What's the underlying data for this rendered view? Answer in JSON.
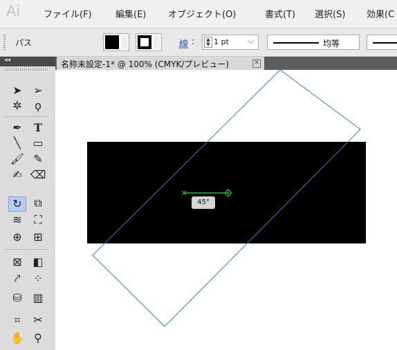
{
  "app": {
    "logo": "Ai"
  },
  "menu": [
    "ファイル(F)",
    "編集(E)",
    "オブジェクト(O)",
    "書式(T)",
    "選択(S)",
    "効果(C"
  ],
  "control": {
    "selection_label": "パス",
    "stroke_link": "線",
    "stroke_colon": ":",
    "stroke_weight": "1 pt",
    "stroke_profile": "均等"
  },
  "document": {
    "tab_title": "名称未設定-1* @ 100% (CMYK/プレビュー)"
  },
  "canvas": {
    "rotation_readout": "45°"
  },
  "colors": {
    "selection_blue": "#3a7bd5",
    "pivot_green": "#2bb52b",
    "fill": "#000000"
  },
  "tools": [
    [
      "selection-tool-icon",
      "direct-selection-tool-icon"
    ],
    [
      "magic-wand-tool-icon",
      "lasso-tool-icon"
    ],
    [
      "pen-tool-icon",
      "type-tool-icon"
    ],
    [
      "line-segment-tool-icon",
      "rectangle-tool-icon"
    ],
    [
      "paintbrush-tool-icon",
      "pencil-tool-icon"
    ],
    [
      "blob-brush-tool-icon",
      "eraser-tool-icon"
    ],
    [
      "rotate-tool-icon",
      "scale-tool-icon"
    ],
    [
      "width-tool-icon",
      "free-transform-tool-icon"
    ],
    [
      "shape-builder-tool-icon",
      "perspective-grid-tool-icon"
    ],
    [
      "mesh-tool-icon",
      "gradient-tool-icon"
    ],
    [
      "eyedropper-tool-icon",
      "blend-tool-icon"
    ],
    [
      "symbol-sprayer-tool-icon",
      "column-graph-tool-icon"
    ],
    [
      "artboard-tool-icon",
      "slice-tool-icon"
    ],
    [
      "hand-tool-icon",
      "zoom-tool-icon"
    ]
  ]
}
